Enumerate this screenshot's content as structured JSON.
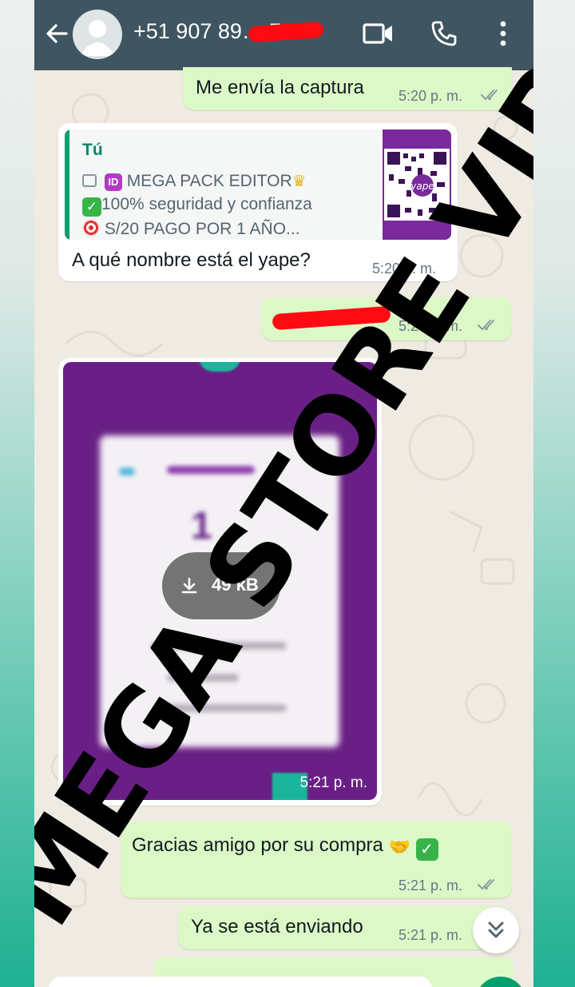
{
  "header": {
    "contact": "+51 907 89… 7",
    "icons": [
      "back-arrow-icon",
      "avatar",
      "video-call-icon",
      "voice-call-icon",
      "more-options-icon"
    ]
  },
  "messages": [
    {
      "id": "m1",
      "direction": "outgoing",
      "text": "Me envía la captura",
      "time": "5:20 p. m.",
      "status": "read"
    },
    {
      "id": "m2",
      "direction": "incoming",
      "quote": {
        "author": "Tú",
        "line1": "MEGA PACK EDITOR",
        "line2": "100% seguridad y confianza",
        "line3": "S/20 PAGO POR 1 AÑO...",
        "thumb_label": "yape"
      },
      "text": "A qué nombre está el yape?",
      "time": "5:20 p. m."
    },
    {
      "id": "m3",
      "direction": "outgoing",
      "text": "",
      "time": "5:20 p. m.",
      "status": "read",
      "redacted": true
    },
    {
      "id": "m4",
      "direction": "incoming",
      "type": "image",
      "download_size": "49 kB",
      "blurred_preview_text": "1",
      "time": "5:21 p. m."
    },
    {
      "id": "m5",
      "direction": "outgoing",
      "text": "Gracias amigo por su compra",
      "time": "5:21 p. m.",
      "status": "read"
    },
    {
      "id": "m6",
      "direction": "outgoing",
      "text": "Ya se está enviando",
      "time": "5:21 p. m.",
      "status": "read"
    }
  ],
  "watermark": "MEGA STORE VIP",
  "colors": {
    "header": "#3f5561",
    "outgoing_bubble": "#dcf8c6",
    "incoming_bubble": "#ffffff",
    "chat_bg": "#efeae2",
    "read_ticks": "#8c9aa3",
    "redaction": "#ff0a12"
  }
}
